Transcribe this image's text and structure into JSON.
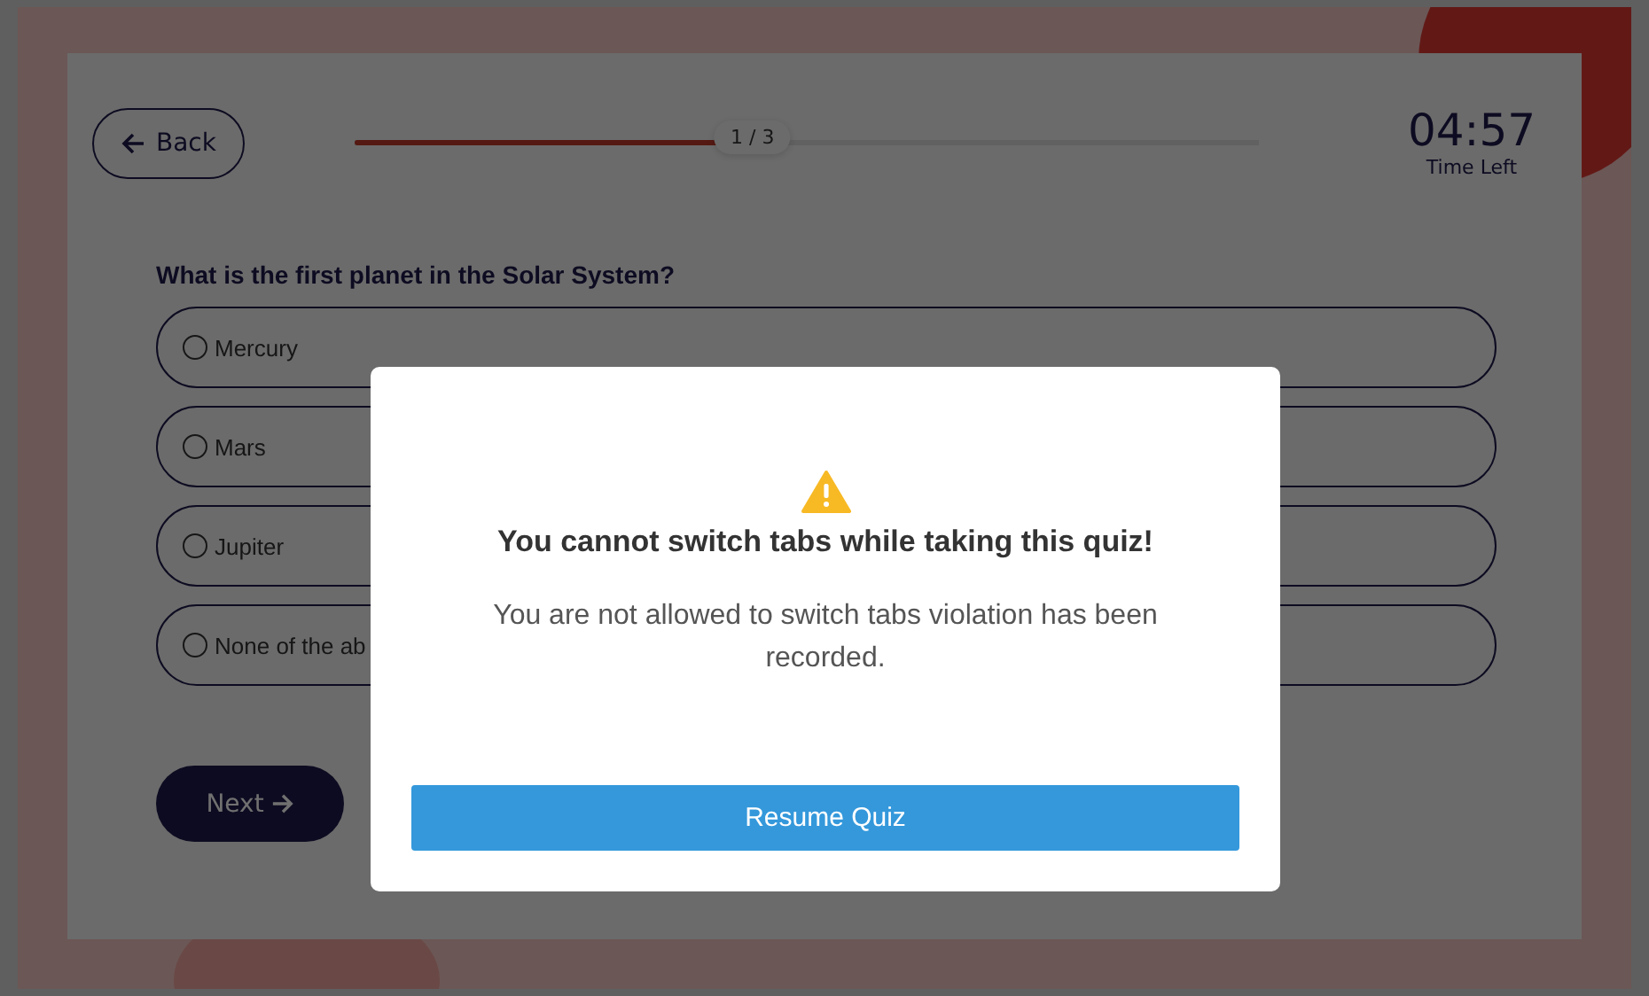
{
  "header": {
    "back_button": "Back",
    "progress": {
      "level": 0.44,
      "label": "1 / 3"
    },
    "timer": {
      "value": "04:57",
      "caption": "Time Left"
    }
  },
  "question": "What is the first planet in the Solar System?",
  "options": [
    {
      "label": "Mercury",
      "selected": false
    },
    {
      "label": "Mars",
      "selected": false
    },
    {
      "label": "Jupiter",
      "selected": false
    },
    {
      "label": "None of the ab",
      "selected": false
    }
  ],
  "next_button": "Next",
  "modal": {
    "title": "You cannot switch tabs while taking this quiz!",
    "message": "You are not allowed to switch tabs violation has been recorded.",
    "button": "Resume Quiz"
  }
}
